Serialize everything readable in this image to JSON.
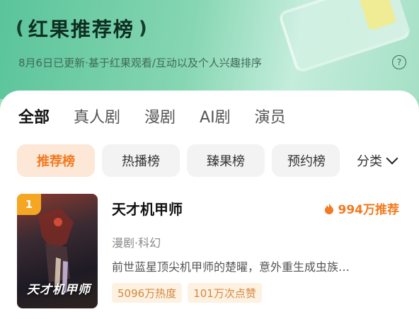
{
  "header": {
    "laurel_left": "(",
    "title": "红果推荐榜",
    "laurel_right": ")",
    "subtitle": "8月6日已更新·基于红果观看/互动以及个人兴趣排序",
    "help_label": "?"
  },
  "tabs": [
    {
      "label": "全部",
      "active": true
    },
    {
      "label": "真人剧"
    },
    {
      "label": "漫剧"
    },
    {
      "label": "AI剧"
    },
    {
      "label": "演员"
    }
  ],
  "chips": [
    {
      "label": "推荐榜",
      "active": true
    },
    {
      "label": "热播榜"
    },
    {
      "label": "臻果榜"
    },
    {
      "label": "预约榜"
    }
  ],
  "sort_label": "分类",
  "item": {
    "rank": "1",
    "poster_title": "天才机甲师",
    "name": "天才机甲师",
    "hot": "994万推荐",
    "genre": "漫剧·科幻",
    "desc": "前世蓝星顶尖机甲师的楚曜，意外重生成虫族…",
    "tags": [
      "5096万热度",
      "101万次点赞"
    ]
  },
  "colors": {
    "accent": "#f27a20",
    "chip_active_bg": "#fde7d6",
    "tag_bg": "#fdf1e2"
  }
}
